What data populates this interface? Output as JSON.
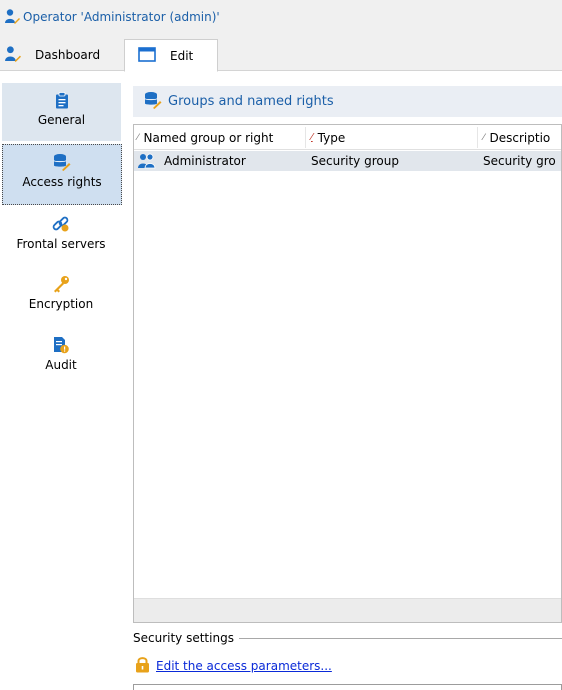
{
  "window": {
    "title": "Operator 'Administrator (admin)'"
  },
  "tabs": [
    {
      "label": "Dashboard",
      "icon": "user-admin-icon"
    },
    {
      "label": "Edit",
      "icon": "window-icon",
      "active": true
    }
  ],
  "sidebar": {
    "items": [
      {
        "label": "General",
        "icon": "clipboard-icon"
      },
      {
        "label": "Access rights",
        "icon": "database-key-icon",
        "selected": true
      },
      {
        "label": "Frontal servers",
        "icon": "chain-link-icon"
      },
      {
        "label": "Encryption",
        "icon": "key-icon"
      },
      {
        "label": "Audit",
        "icon": "audit-icon"
      }
    ]
  },
  "panel": {
    "header": "Groups and named rights",
    "columns": [
      "Named group or right",
      "Type",
      "Descriptio"
    ],
    "rows": [
      {
        "name": "Administrator",
        "type": "Security group",
        "description": "Security gro"
      }
    ]
  },
  "security": {
    "title": "Security settings",
    "link": "Edit the access parameters..."
  },
  "colors": {
    "accent": "#1b5fa8",
    "link": "#0a2ad8",
    "selection": "#cfdff0"
  }
}
